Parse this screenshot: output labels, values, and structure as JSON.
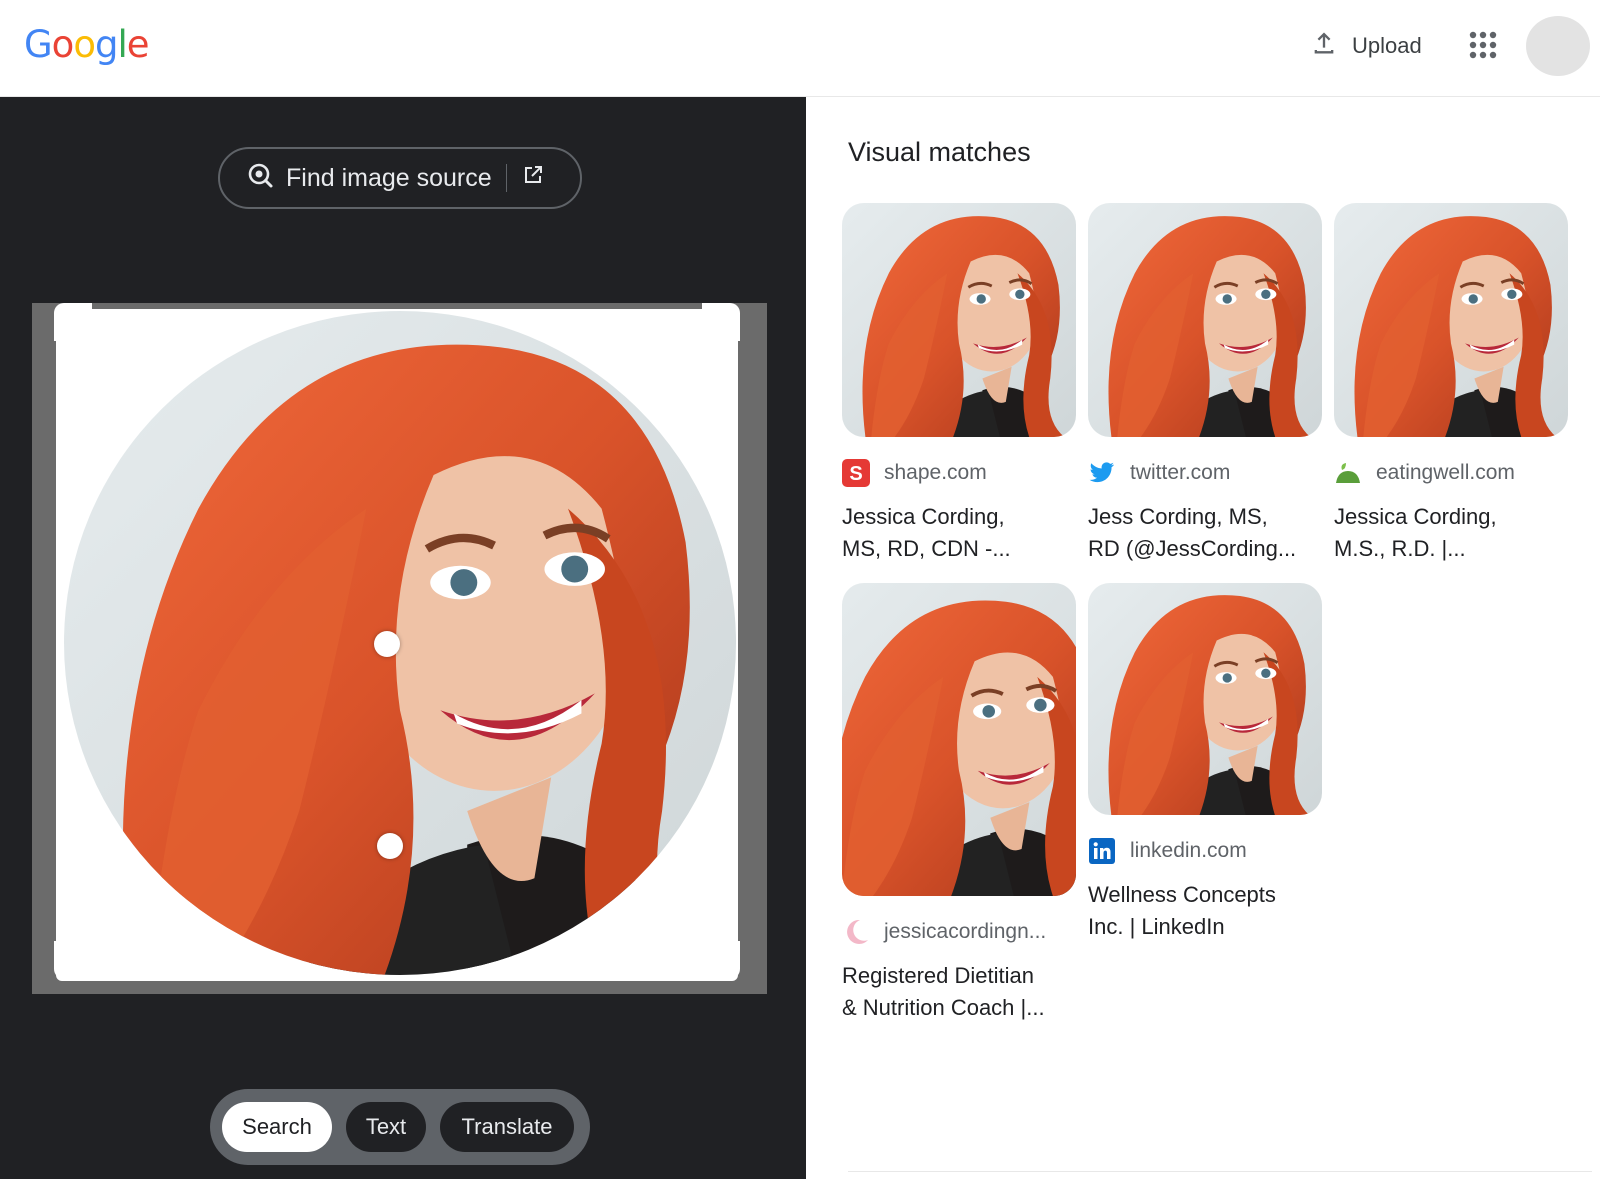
{
  "header": {
    "logo_letters": [
      {
        "ch": "G",
        "color": "#4285F4"
      },
      {
        "ch": "o",
        "color": "#EA4335"
      },
      {
        "ch": "o",
        "color": "#FBBC05"
      },
      {
        "ch": "g",
        "color": "#4285F4"
      },
      {
        "ch": "l",
        "color": "#34A853"
      },
      {
        "ch": "e",
        "color": "#EA4335"
      }
    ],
    "upload_label": "Upload",
    "icons": [
      "upload-icon",
      "apps-grid-icon"
    ]
  },
  "left_panel": {
    "find_source_label": "Find image source",
    "icons": [
      "lens-search-icon",
      "open-in-new-icon"
    ],
    "modes": [
      {
        "label": "Search",
        "active": true
      },
      {
        "label": "Text",
        "active": false
      },
      {
        "label": "Translate",
        "active": false
      }
    ]
  },
  "visual_matches": {
    "title": "Visual matches",
    "items": [
      {
        "site": "shape.com",
        "favicon": "shape-favicon",
        "caption": "Jessica Cording,\nMS, RD, CDN -..."
      },
      {
        "site": "twitter.com",
        "favicon": "twitter-bird-icon",
        "caption": "Jess Cording, MS,\nRD (@JessCording..."
      },
      {
        "site": "eatingwell.com",
        "favicon": "eatingwell-favicon",
        "caption": "Jessica Cording,\nM.S., R.D. |..."
      },
      {
        "site": "jessicacordingn...",
        "favicon": "crescent-favicon",
        "caption": "Registered Dietitian\n& Nutrition Coach |..."
      },
      {
        "site": "linkedin.com",
        "favicon": "linkedin-favicon",
        "caption": "Wellness Concepts\nInc. | LinkedIn"
      }
    ]
  },
  "colors": {
    "dark_bg": "#202124",
    "hair": "#d9532a",
    "accent_blue": "#1a73e8"
  }
}
